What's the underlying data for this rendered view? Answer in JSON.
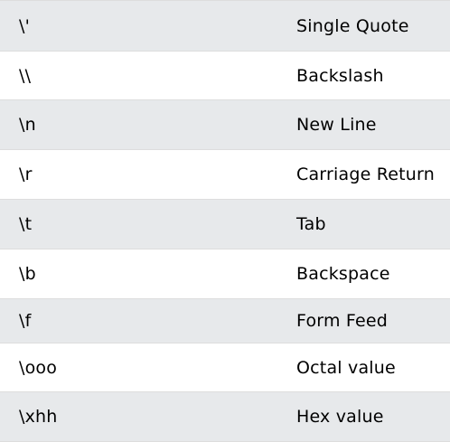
{
  "escape_table": {
    "rows": [
      {
        "code": "\\'",
        "description": "Single Quote"
      },
      {
        "code": "\\\\",
        "description": "Backslash"
      },
      {
        "code": "\\n",
        "description": "New Line"
      },
      {
        "code": "\\r",
        "description": "Carriage Return"
      },
      {
        "code": "\\t",
        "description": "Tab"
      },
      {
        "code": "\\b",
        "description": "Backspace"
      },
      {
        "code": "\\f",
        "description": "Form Feed"
      },
      {
        "code": "\\ooo",
        "description": "Octal value"
      },
      {
        "code": "\\xhh",
        "description": "Hex value"
      }
    ]
  }
}
